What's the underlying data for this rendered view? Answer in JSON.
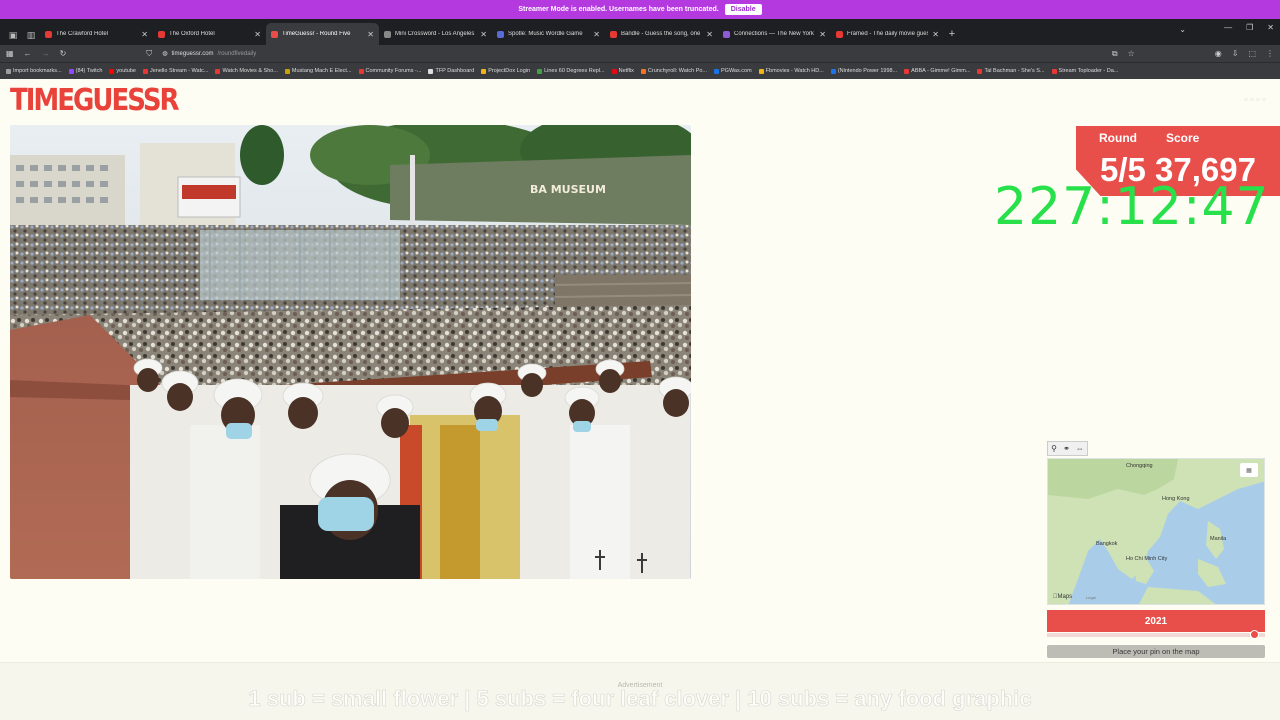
{
  "streamer_banner": {
    "message": "Streamer Mode is enabled. Usernames have been truncated.",
    "disable_label": "Disable"
  },
  "tabs": [
    {
      "title": "The Crawford Hotel",
      "fav_color": "#e53935"
    },
    {
      "title": "The Oxford Hotel",
      "fav_color": "#e53935"
    },
    {
      "title": "TimeGuessr - Round Five",
      "fav_color": "#e84e4a",
      "active": true
    },
    {
      "title": "Mini Crossword - Los Angeles T",
      "fav_color": "#888888"
    },
    {
      "title": "Spotle: Music Wordle Game",
      "fav_color": "#5b6bd6"
    },
    {
      "title": "Bandle - Guess the song, one in",
      "fav_color": "#e53935"
    },
    {
      "title": "Connections — The New York T",
      "fav_color": "#8e5bd6"
    },
    {
      "title": "Framed - The daily movie gues",
      "fav_color": "#e53935"
    }
  ],
  "address": {
    "host": "timeguessr.com",
    "path": "/roundfivedaily"
  },
  "bookmarks": [
    {
      "label": "Import bookmarks...",
      "color": "#9e9e9e"
    },
    {
      "label": "(84) Twitch",
      "color": "#9146ff"
    },
    {
      "label": "youtube",
      "color": "#ff0000"
    },
    {
      "label": "Jenello Stream - Watc...",
      "color": "#e53935"
    },
    {
      "label": "Watch Movies & Sho...",
      "color": "#e53935"
    },
    {
      "label": "Mustang Mach E Elect...",
      "color": "#c8a200"
    },
    {
      "label": "Community Forums -...",
      "color": "#e53935"
    },
    {
      "label": "TFP Dashboard",
      "color": "#dddddd"
    },
    {
      "label": "ProjectDox Login",
      "color": "#f2b21a"
    },
    {
      "label": "Lines 60 Degrees Repl...",
      "color": "#43a047"
    },
    {
      "label": "Netflix",
      "color": "#e50914"
    },
    {
      "label": "Crunchyroll: Watch Po...",
      "color": "#f47521"
    },
    {
      "label": "PGWas.com",
      "color": "#1a73e8"
    },
    {
      "label": "Fbmovies - Watch HD...",
      "color": "#f2b21a"
    },
    {
      "label": "(Nintendo Power 1998...",
      "color": "#1a73e8"
    },
    {
      "label": "ABBA - Gimme! Gimm...",
      "color": "#e53935"
    },
    {
      "label": "Tal Bachman - She's S...",
      "color": "#e53935"
    },
    {
      "label": "Stream Toploader - Da...",
      "color": "#e53935"
    }
  ],
  "page": {
    "logo_text": "TIMEGUESSR",
    "round_label": "Round",
    "score_label": "Score",
    "round_value": "5/5",
    "score_value": "37,697",
    "timer": "227:12:47",
    "map": {
      "brand": "Maps",
      "legal": "Legal",
      "labels": [
        {
          "text": "Chongqing"
        },
        {
          "text": "Hong Kong"
        },
        {
          "text": "Bangkok"
        },
        {
          "text": "Ho Chi Minh City"
        },
        {
          "text": "Manila"
        }
      ]
    },
    "year": "2021",
    "year_fraction": 0.95,
    "pin_button": "Place your pin on the map",
    "advertisement": "Advertisement",
    "stream_overlay": "1 sub = small flower | 5 subs = four leaf clover | 10 subs = any food graphic",
    "museum_sign": "BA MUSEUM"
  },
  "colors": {
    "accent": "#e84e4a",
    "timer": "#27e04a",
    "streamer": "#b43ae0"
  }
}
